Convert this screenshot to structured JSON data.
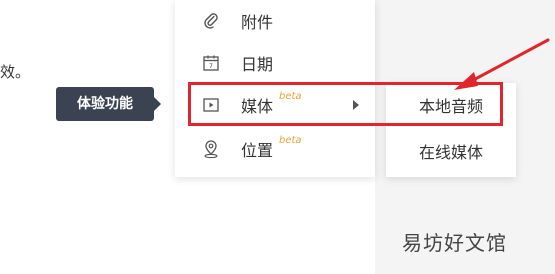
{
  "partial_text": "效。",
  "tooltip": {
    "label": "体验功能"
  },
  "menu": {
    "items": [
      {
        "label": "附件",
        "icon": "paperclip-icon"
      },
      {
        "label": "日期",
        "icon": "calendar-icon"
      },
      {
        "label": "媒体",
        "icon": "media-play-icon",
        "beta": "beta",
        "has_submenu": true
      },
      {
        "label": "位置",
        "icon": "location-pin-icon",
        "beta": "beta"
      }
    ]
  },
  "submenu": {
    "items": [
      {
        "label": "本地音频"
      },
      {
        "label": "在线媒体"
      }
    ]
  },
  "annotation": {
    "highlight_color": "#e0262b"
  },
  "watermark": "易坊好文馆"
}
